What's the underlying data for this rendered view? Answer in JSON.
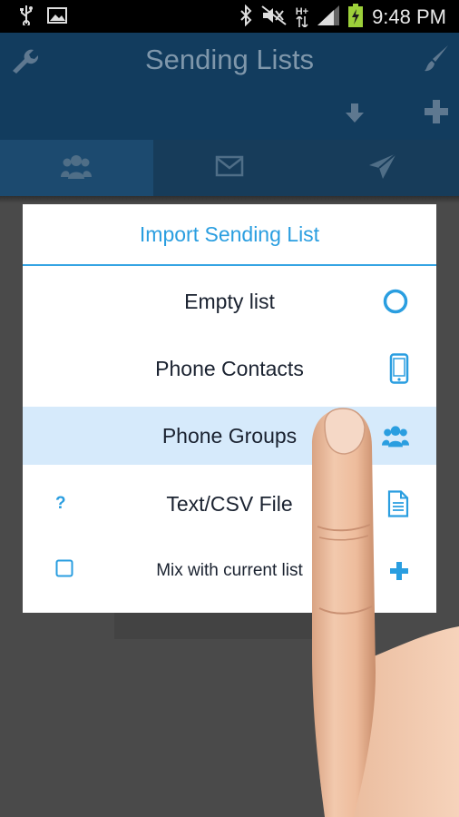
{
  "status_bar": {
    "time": "9:48 PM",
    "left_icons": [
      "usb-icon",
      "image-icon"
    ],
    "right_icons": [
      "bluetooth-icon",
      "mute-icon",
      "network-type-icon",
      "signal-icon",
      "battery-icon"
    ],
    "network_label": "H+"
  },
  "app_bar": {
    "title": "Sending Lists",
    "left_icon": "wrench-icon",
    "right_icon": "brush-icon",
    "actions": [
      "download-icon",
      "add-icon"
    ]
  },
  "tabs": [
    {
      "icon": "contacts-group-icon",
      "active": true
    },
    {
      "icon": "envelope-icon",
      "active": false
    },
    {
      "icon": "send-icon",
      "active": false
    }
  ],
  "dialog": {
    "title": "Import Sending List",
    "options": [
      {
        "label": "Empty list",
        "icon": "circle-icon"
      },
      {
        "label": "Phone Contacts",
        "icon": "smartphone-icon"
      },
      {
        "label": "Phone Groups",
        "icon": "group-icon",
        "highlighted": true
      },
      {
        "label": "Text/CSV File",
        "icon": "file-icon",
        "lead": "?"
      },
      {
        "label": "Mix with current list",
        "icon": "plus-icon"
      }
    ]
  },
  "colors": {
    "accent": "#2a9ee0",
    "appbar": "#123c5e",
    "highlight": "#d6eafb"
  }
}
